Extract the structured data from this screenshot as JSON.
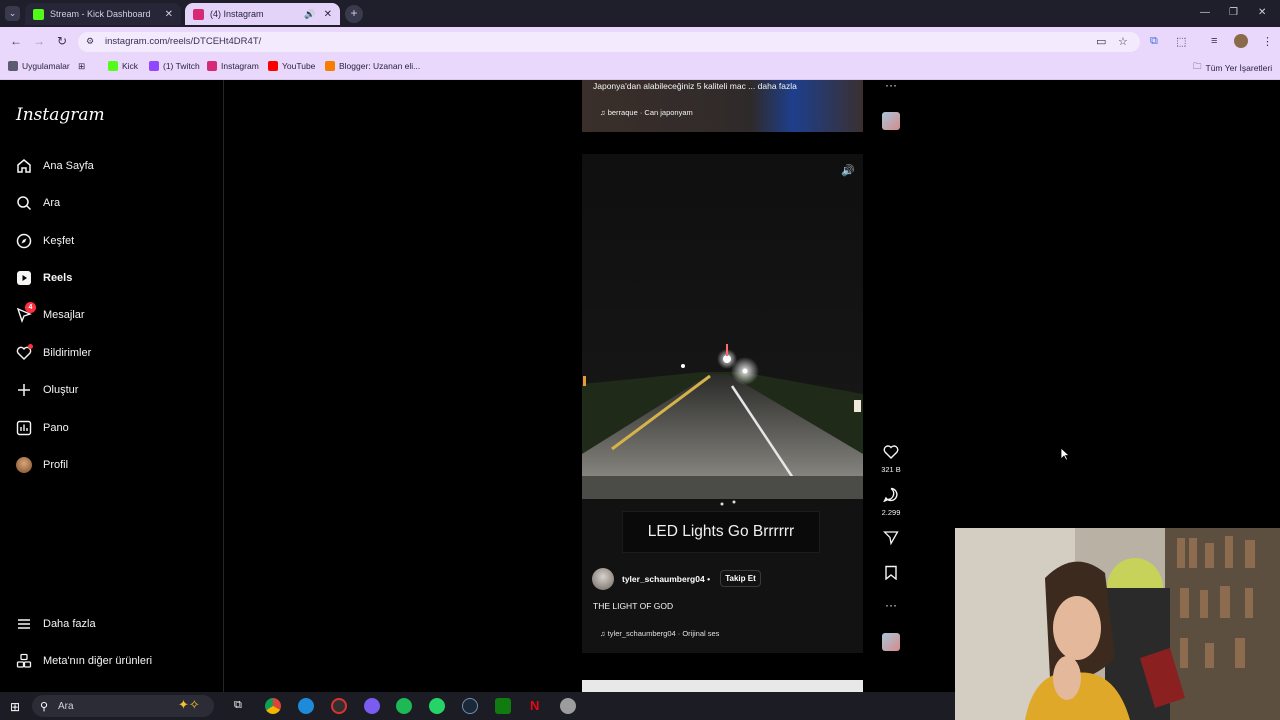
{
  "browser": {
    "tabs": [
      {
        "label": "Stream - Kick Dashboard",
        "close": "✕",
        "color": "#53fc18"
      },
      {
        "label": "(4) Instagram",
        "close": "✕",
        "color": "#d62976"
      }
    ],
    "new_tab": "+",
    "url": "instagram.com/reels/DTCEHt4DR4T/",
    "bookmarks": [
      {
        "label": "Uygulamalar",
        "color": "#5c5c70"
      },
      {
        "label": "Kick",
        "color": "#53fc18"
      },
      {
        "label": "(1) Twitch",
        "color": "#9146ff"
      },
      {
        "label": "Instagram",
        "color": "#d62976"
      },
      {
        "label": "YouTube",
        "color": "#ff0000"
      },
      {
        "label": "Blogger: Uzanan eli...",
        "color": "#f57d00"
      }
    ],
    "all_bookmarks": "Tüm Yer İşaretleri"
  },
  "instagram": {
    "logo": "Instagram",
    "nav": [
      {
        "label": "Ana Sayfa",
        "icon": "home-icon",
        "glyph": "⌂"
      },
      {
        "label": "Ara",
        "icon": "search-icon",
        "glyph": "⚲"
      },
      {
        "label": "Keşfet",
        "icon": "compass-icon",
        "glyph": "◎"
      },
      {
        "label": "Reels",
        "icon": "reels-icon",
        "glyph": "▶"
      },
      {
        "label": "Mesajlar",
        "icon": "messenger-icon",
        "glyph": "✉",
        "badge": "4"
      },
      {
        "label": "Bildirimler",
        "icon": "heart-icon",
        "glyph": "♡"
      },
      {
        "label": "Oluştur",
        "icon": "plus-icon",
        "glyph": "+"
      },
      {
        "label": "Pano",
        "icon": "dashboard-icon",
        "glyph": "▥"
      },
      {
        "label": "Profil",
        "icon": "profile-avatar",
        "glyph": "●"
      }
    ],
    "more": "Daha fazla",
    "meta": "Meta'nın diğer ürünleri"
  },
  "reel_prev": {
    "caption": "Japonya'dan alabileceğiniz 5 kaliteli mac ... daha fazla",
    "audio": "berraque · Can japonyam"
  },
  "reel": {
    "overlay_text": "LED Lights Go Brrrrrr",
    "username": "tyler_schaumberg04",
    "separator": "•",
    "follow": "Takip Et",
    "description": "THE LIGHT OF GOD",
    "audio": "tyler_schaumberg04 · Orijinal ses",
    "likes": "321 B",
    "comments": "2.299"
  },
  "taskbar": {
    "search": "Ara"
  }
}
